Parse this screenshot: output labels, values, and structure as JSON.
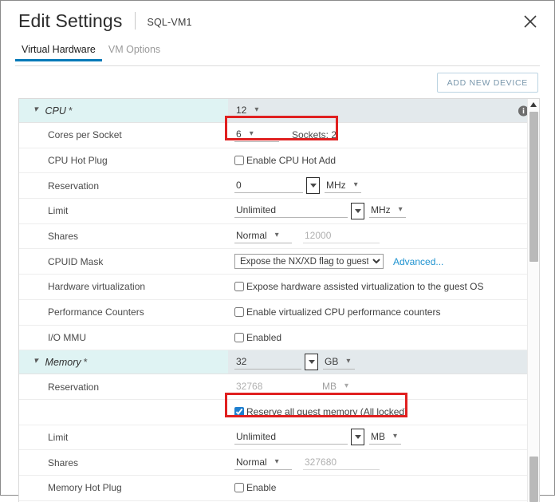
{
  "window": {
    "title": "Edit Settings",
    "subtitle": "SQL-VM1",
    "close_icon": "close-icon"
  },
  "tabs": [
    {
      "label": "Virtual Hardware",
      "active": true
    },
    {
      "label": "VM Options",
      "active": false
    }
  ],
  "toolbar": {
    "add_new_device_label": "ADD NEW DEVICE"
  },
  "sections": {
    "cpu": {
      "label": "CPU",
      "required_marker": "*",
      "value": "12",
      "info_icon": "info-icon",
      "rows": {
        "cores_per_socket": {
          "label": "Cores per Socket",
          "value": "6",
          "sockets_text": "Sockets: 2",
          "highlighted": true
        },
        "cpu_hot_plug": {
          "label": "CPU Hot Plug",
          "checkbox_label": "Enable CPU Hot Add",
          "checked": false
        },
        "reservation": {
          "label": "Reservation",
          "value": "0",
          "unit": "MHz"
        },
        "limit": {
          "label": "Limit",
          "value": "Unlimited",
          "unit": "MHz"
        },
        "shares": {
          "label": "Shares",
          "level": "Normal",
          "value": "12000"
        },
        "cpuid_mask": {
          "label": "CPUID Mask",
          "selected": "Expose the NX/XD flag to guest",
          "link_label": "Advanced..."
        },
        "hardware_virtualization": {
          "label": "Hardware virtualization",
          "checkbox_label": "Expose hardware assisted virtualization to the guest OS",
          "checked": false
        },
        "performance_counters": {
          "label": "Performance Counters",
          "checkbox_label": "Enable virtualized CPU performance counters",
          "checked": false
        },
        "io_mmu": {
          "label": "I/O MMU",
          "checkbox_label": "Enabled",
          "checked": false
        }
      }
    },
    "memory": {
      "label": "Memory",
      "required_marker": "*",
      "value": "32",
      "unit": "GB",
      "rows": {
        "reservation": {
          "label": "Reservation",
          "value": "32768",
          "unit": "MB"
        },
        "reserve_all": {
          "checkbox_label": "Reserve all guest memory (All locked)",
          "checked": true,
          "highlighted": true
        },
        "limit": {
          "label": "Limit",
          "value": "Unlimited",
          "unit": "MB"
        },
        "shares": {
          "label": "Shares",
          "level": "Normal",
          "value": "327680"
        },
        "memory_hot_plug": {
          "label": "Memory Hot Plug",
          "checkbox_label": "Enable",
          "checked": false
        }
      }
    }
  },
  "colors": {
    "accent_blue": "#0079b8",
    "section_label_bg": "#dff3f3",
    "section_value_bg": "#e3e9ec",
    "highlight_red": "#e02020",
    "link_blue": "#1f93d0"
  }
}
